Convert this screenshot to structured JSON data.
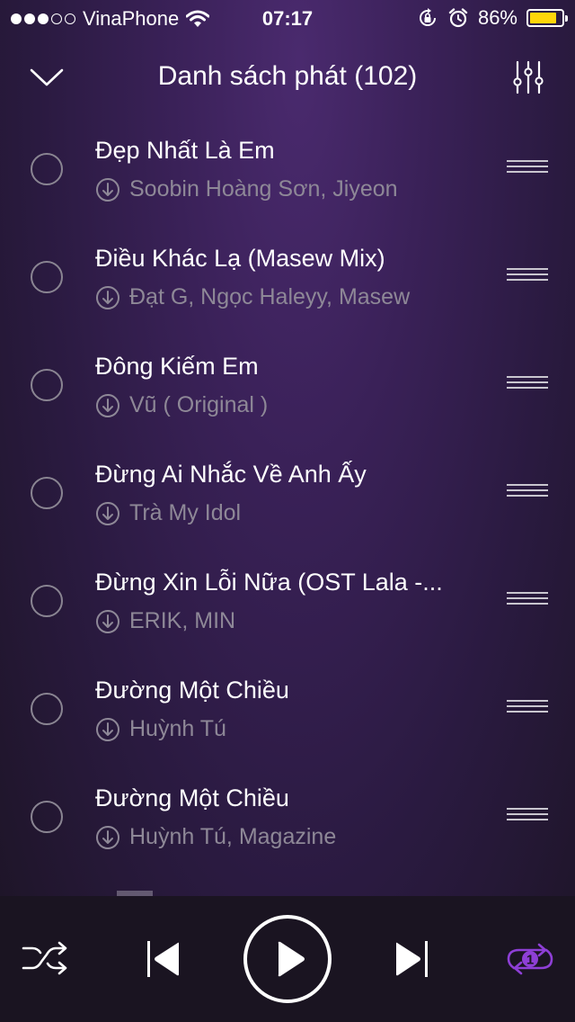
{
  "status_bar": {
    "carrier": "VinaPhone",
    "time": "07:17",
    "battery_percent": "86%",
    "battery_level": 0.86,
    "battery_color": "#ffd60a",
    "signal_bars_filled": 3,
    "signal_bars_total": 5
  },
  "header": {
    "title": "Danh sách phát (102)",
    "collapse_icon": "chevron-down-icon",
    "settings_icon": "equalizer-sliders-icon"
  },
  "playlist": [
    {
      "title": "Đẹp Nhất Là Em",
      "artist": "Soobin Hoàng Sơn, Jiyeon"
    },
    {
      "title": "Điều Khác Lạ (Masew Mix)",
      "artist": "Đạt G, Ngọc Haleyy, Masew"
    },
    {
      "title": "Đông Kiếm Em",
      "artist": "Vũ ( Original )"
    },
    {
      "title": "Đừng Ai Nhắc Về Anh Ấy",
      "artist": "Trà My Idol"
    },
    {
      "title": "Đừng Xin Lỗi Nữa (OST Lala -...",
      "artist": "ERIK, MIN"
    },
    {
      "title": "Đường Một Chiều",
      "artist": "Huỳnh Tú"
    },
    {
      "title": "Đường Một Chiều",
      "artist": "Huỳnh Tú, Magazine"
    }
  ],
  "player": {
    "shuffle_icon": "shuffle-icon",
    "previous_icon": "skip-previous-icon",
    "play_icon": "play-icon",
    "next_icon": "skip-next-icon",
    "repeat_icon": "repeat-one-icon",
    "repeat_badge": "1",
    "accent_color": "#8e3fd6"
  }
}
